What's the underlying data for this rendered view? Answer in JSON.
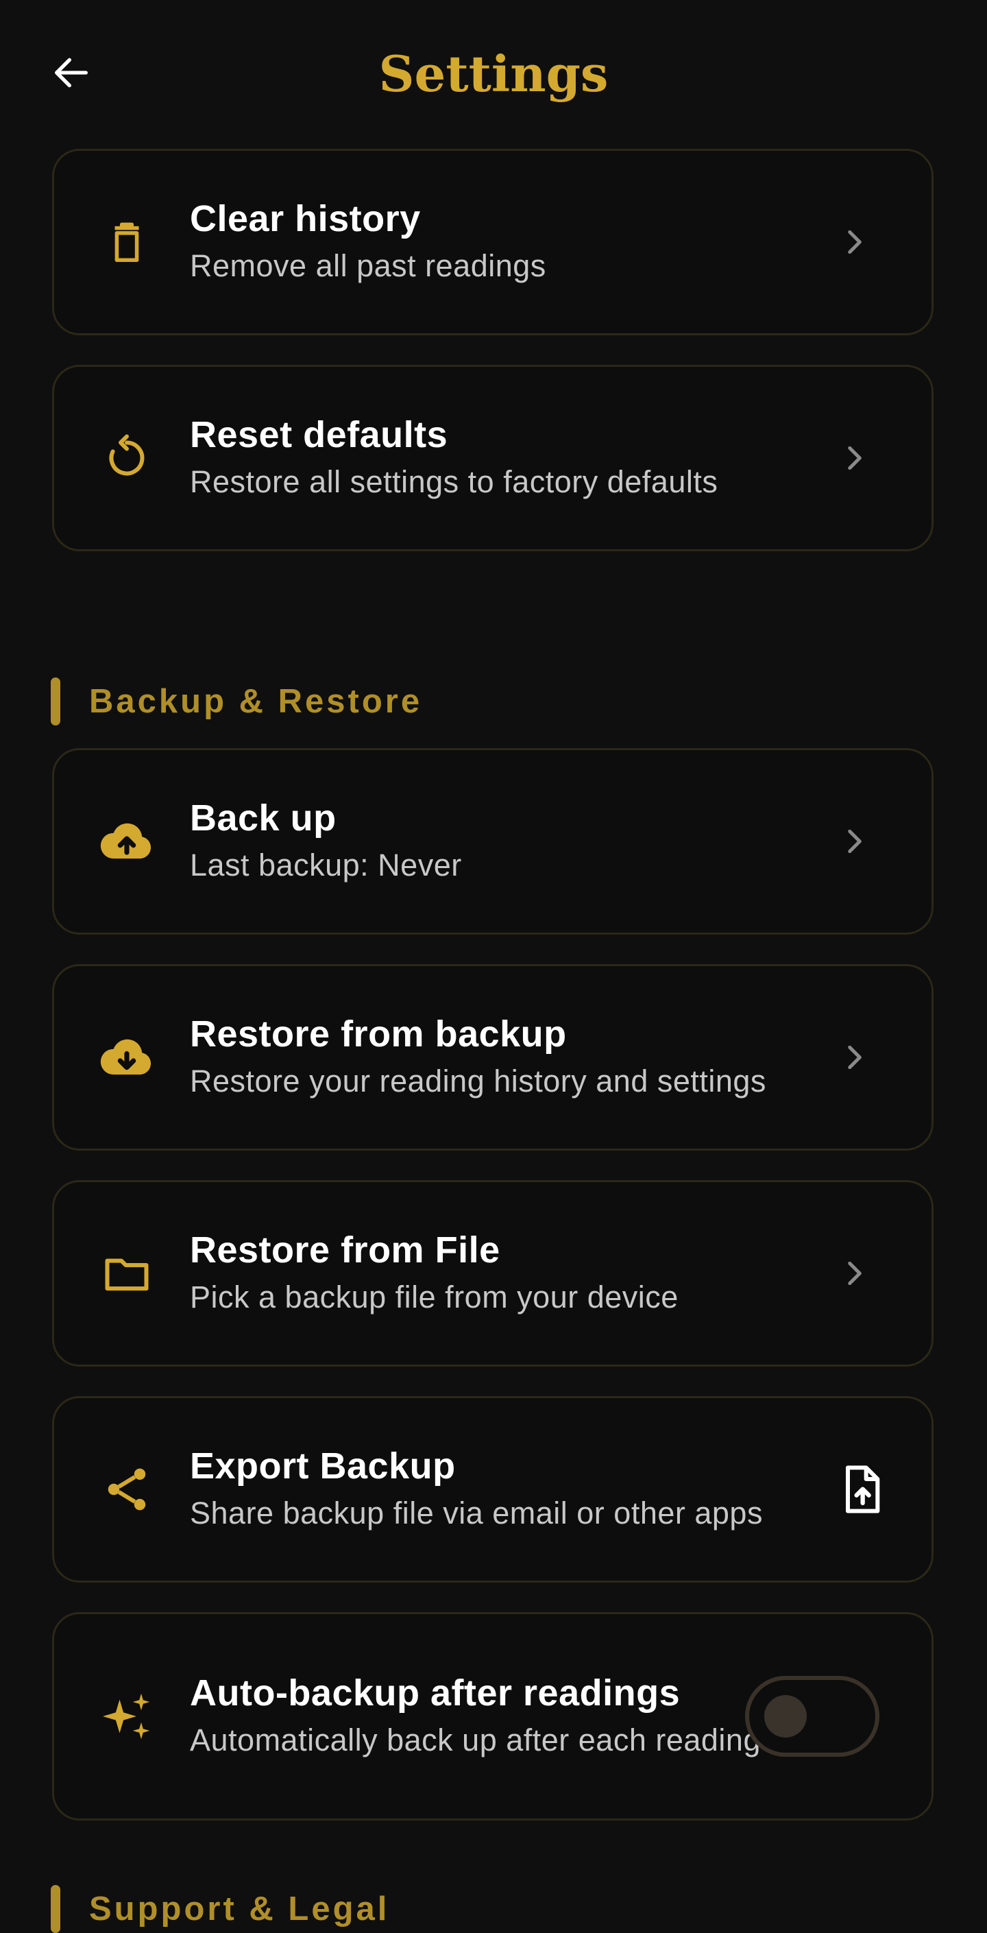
{
  "header": {
    "title": "Settings",
    "back_icon": "arrow-left-icon"
  },
  "accent_color": "#d4a92f",
  "data_cards": [
    {
      "title": "Clear history",
      "subtitle": "Remove all past readings",
      "icon": "trash-icon",
      "trailing": "chevron-right-icon"
    },
    {
      "title": "Reset defaults",
      "subtitle": "Restore all settings to factory defaults",
      "icon": "refresh-icon",
      "trailing": "chevron-right-icon"
    }
  ],
  "backup_section": {
    "label": "Backup & Restore",
    "items": [
      {
        "title": "Back up",
        "subtitle": "Last backup: Never",
        "icon": "cloud-upload-icon",
        "trailing": "chevron-right-icon"
      },
      {
        "title": "Restore from backup",
        "subtitle": "Restore your reading history and settings",
        "icon": "cloud-download-icon",
        "trailing": "chevron-right-icon"
      },
      {
        "title": "Restore from File",
        "subtitle": "Pick a backup file from your device",
        "icon": "folder-icon",
        "trailing": "chevron-right-icon"
      },
      {
        "title": "Export Backup",
        "subtitle": "Share backup file via email or other apps",
        "icon": "share-icon",
        "trailing": "file-upload-icon"
      },
      {
        "title": "Auto-backup after readings",
        "subtitle": "Automatically back up after each reading",
        "icon": "sparkles-icon",
        "toggle_on": false
      }
    ]
  },
  "support_section": {
    "label": "Support & Legal"
  }
}
